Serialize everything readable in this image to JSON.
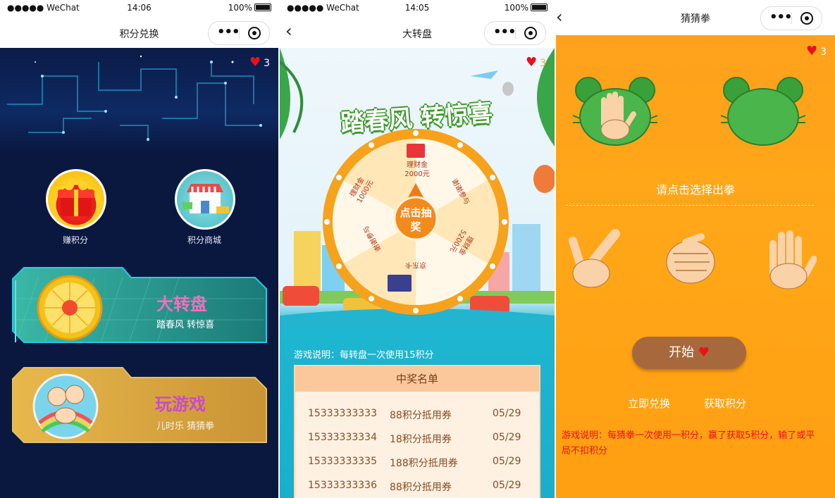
{
  "colors": {
    "heart": "#e8111c",
    "accent_orange": "#ffa11c",
    "dark_bg": "#0a1840"
  },
  "screen1": {
    "status": {
      "carrier": "●●●●● WeChat",
      "time": "14:06",
      "battery": "100%"
    },
    "nav": {
      "title": "积分兑换"
    },
    "hearts": "3",
    "earn_label": "赚积分",
    "mall_label": "积分商城",
    "wheel_card": {
      "title": "大转盘",
      "subtitle": "踏春风 转惊喜"
    },
    "game_card": {
      "title": "玩游戏",
      "subtitle": "儿时乐 猜猜拳"
    }
  },
  "screen2": {
    "status": {
      "carrier": "●●●●● WeChat",
      "time": "14:05",
      "battery": "100%"
    },
    "nav": {
      "title": "大转盘"
    },
    "hearts": "3",
    "banner_text": "踏春风 转惊喜",
    "wheel_center": "点击抽奖",
    "prizes": [
      "理财金 2000元",
      "理财金 1000元",
      "谢谢参与",
      "谢谢参与",
      "理财金 5200元",
      "京东卡"
    ],
    "game_desc": "游戏说明：每转盘一次使用15积分",
    "winners_title": "中奖名单",
    "winners": [
      {
        "phone": "15333333333",
        "prize": "88积分抵用券",
        "date": "05/29"
      },
      {
        "phone": "15333333334",
        "prize": "18积分抵用券",
        "date": "05/29"
      },
      {
        "phone": "15333333335",
        "prize": "188积分抵用券",
        "date": "05/29"
      },
      {
        "phone": "15333333336",
        "prize": "88积分抵用券",
        "date": "05/29"
      }
    ]
  },
  "screen3": {
    "nav": {
      "title": "猜猜拳"
    },
    "hearts": "3",
    "prompt": "请点击选择出拳",
    "start_label": "开始",
    "exchange_label": "立即兑换",
    "get_points_label": "获取积分",
    "rules": "游戏说明：每猜拳一次使用一积分，赢了获取5积分，输了或平局不扣积分"
  }
}
